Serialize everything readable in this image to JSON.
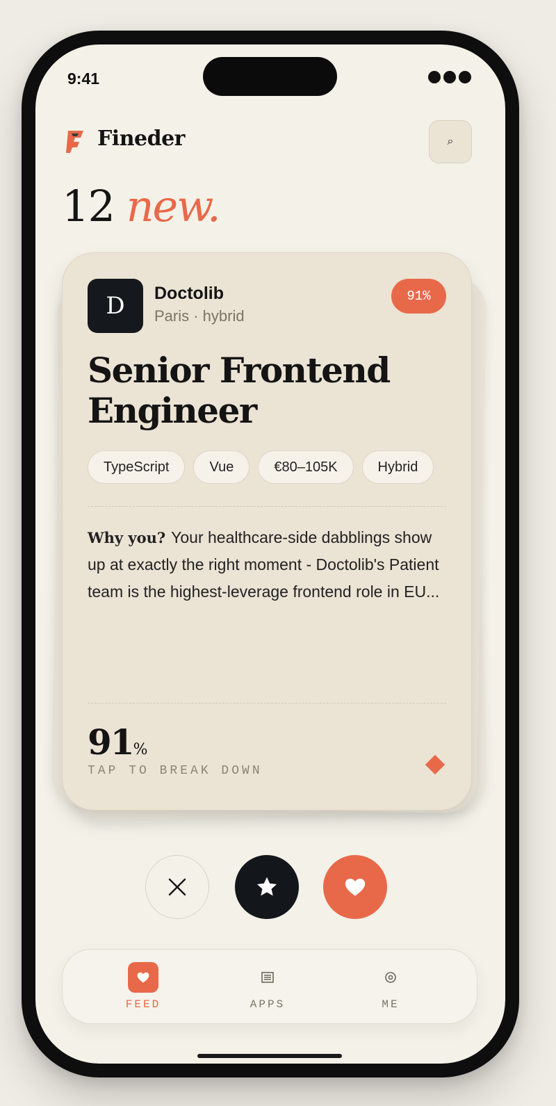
{
  "status_bar": {
    "time": "9:41"
  },
  "header": {
    "brand": "Fineder",
    "search_icon": "⌕"
  },
  "headline": {
    "count": "12",
    "accent": "new."
  },
  "card": {
    "company_initial": "D",
    "company_name": "Doctolib",
    "location": "Paris · hybrid",
    "match_badge": "91%",
    "job_title": "Senior Frontend Engineer",
    "tags": [
      "TypeScript",
      "Vue",
      "€80–105K",
      "Hybrid"
    ],
    "why_label": "Why you?",
    "why_text": "Your healthcare-side dabblings show up at exactly the right moment - Doctolib's Patient team is the highest-leverage frontend role in EU...",
    "score_value": "91",
    "score_unit": "%",
    "tap_label": "TAP TO BREAK DOWN"
  },
  "actions": {
    "pass_icon": "close-icon",
    "star_icon": "star-icon",
    "like_icon": "heart-icon"
  },
  "tabbar": {
    "items": [
      {
        "label": "FEED",
        "icon": "heart-icon",
        "active": true
      },
      {
        "label": "APPS",
        "icon": "list-icon",
        "active": false
      },
      {
        "label": "ME",
        "icon": "target-icon",
        "active": false
      }
    ]
  },
  "colors": {
    "accent": "#e8694a",
    "ink": "#141414",
    "card": "#ebe3d4",
    "screen": "#f4f1e8"
  }
}
